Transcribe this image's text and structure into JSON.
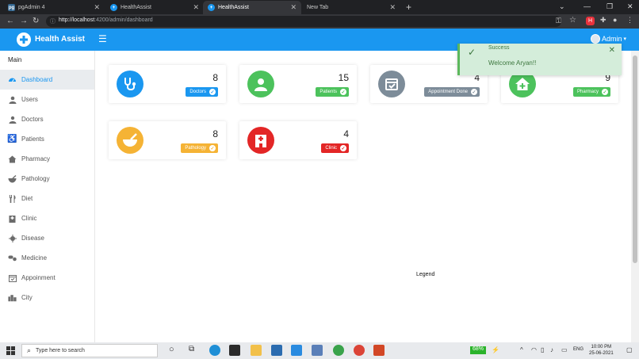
{
  "browser": {
    "tabs": [
      {
        "label": "pgAdmin 4",
        "favicon": "pg"
      },
      {
        "label": "HealthAssist"
      },
      {
        "label": "HealthAssist"
      },
      {
        "label": "New Tab"
      }
    ],
    "url_host": "http://localhost",
    "url_path": ":4200/admin/dashboard"
  },
  "header": {
    "brand": "Health Assist",
    "user": "Admin"
  },
  "sidebar": {
    "section": "Main",
    "items": [
      {
        "label": "Dashboard",
        "icon": "dashboard-icon",
        "active": true
      },
      {
        "label": "Users",
        "icon": "user-icon"
      },
      {
        "label": "Doctors",
        "icon": "doctor-icon"
      },
      {
        "label": "Patients",
        "icon": "wheelchair-icon"
      },
      {
        "label": "Pharmacy",
        "icon": "clinic-house-icon"
      },
      {
        "label": "Pathology",
        "icon": "mortar-icon"
      },
      {
        "label": "Diet",
        "icon": "utensils-icon"
      },
      {
        "label": "Clinic",
        "icon": "hospital-icon"
      },
      {
        "label": "Disease",
        "icon": "virus-icon"
      },
      {
        "label": "Medicine",
        "icon": "pills-icon"
      },
      {
        "label": "Appoinment",
        "icon": "calendar-check-icon"
      },
      {
        "label": "City",
        "icon": "city-icon"
      }
    ]
  },
  "cards": [
    {
      "count": "8",
      "badge": "Doctors",
      "icon": "stethoscope-icon",
      "color": "#1a97f0"
    },
    {
      "count": "15",
      "badge": "Patients",
      "icon": "person-icon",
      "color": "#4cc25c"
    },
    {
      "count": "4",
      "badge": "Appointment Done",
      "icon": "calendar-check-icon",
      "color": "#7d8c99"
    },
    {
      "count": "9",
      "badge": "Pharmacy",
      "icon": "clinic-house-icon",
      "color": "#4cc25c"
    },
    {
      "count": "8",
      "badge": "Pathology",
      "icon": "mortar-icon",
      "color": "#f5b335"
    },
    {
      "count": "4",
      "badge": "Clinic",
      "icon": "hospital-icon",
      "color": "#e32626"
    }
  ],
  "legend": "Legend",
  "toast": {
    "title": "Success",
    "message": "Welcome Aryan!!"
  },
  "taskbar": {
    "search_placeholder": "Type here to search",
    "battery": "68%",
    "lang": "ENG",
    "time": "10:00 PM",
    "date": "25-06-2021"
  }
}
